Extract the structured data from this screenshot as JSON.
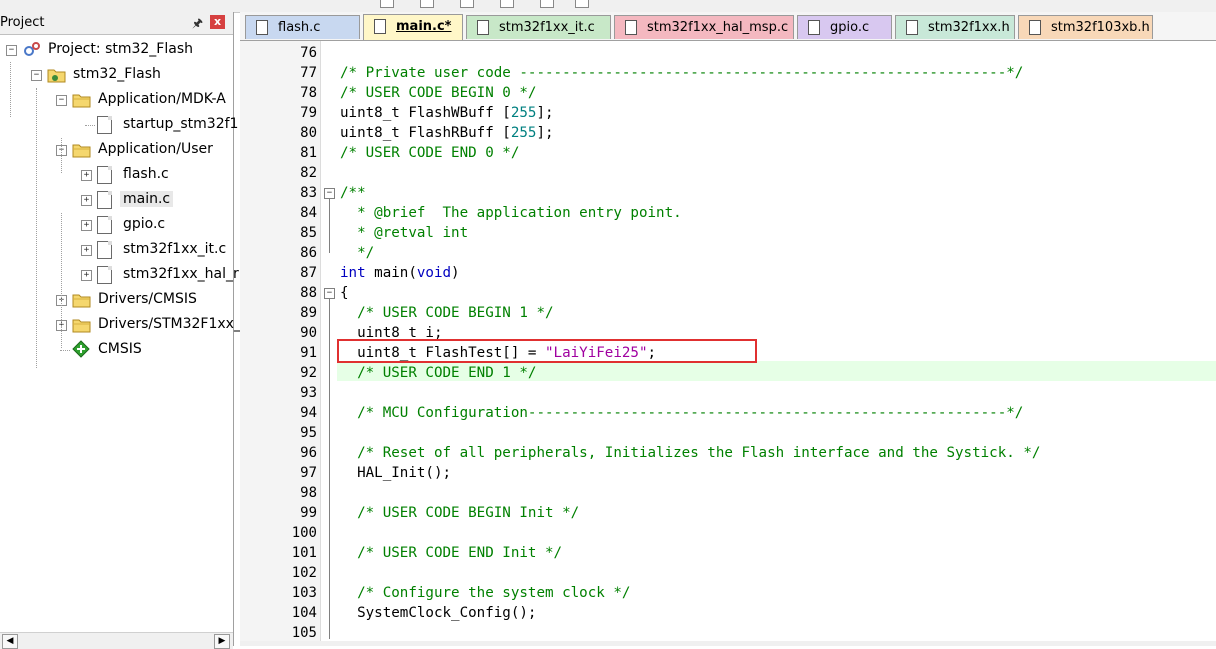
{
  "project_panel": {
    "title": "Project",
    "pin_icon": "pin-icon",
    "close_label": "x",
    "tree": [
      {
        "label": "Project: stm32_Flash",
        "depth": 0,
        "kind": "project",
        "expander": "-"
      },
      {
        "label": "stm32_Flash",
        "depth": 1,
        "kind": "target",
        "expander": "-"
      },
      {
        "label": "Application/MDK-A",
        "depth": 2,
        "kind": "folder",
        "expander": "-"
      },
      {
        "label": "startup_stm32f1",
        "depth": 3,
        "kind": "file",
        "expander": ""
      },
      {
        "label": "Application/User",
        "depth": 2,
        "kind": "folder",
        "expander": "-"
      },
      {
        "label": "flash.c",
        "depth": 3,
        "kind": "file",
        "expander": "+"
      },
      {
        "label": "main.c",
        "depth": 3,
        "kind": "file",
        "expander": "+",
        "selected": true
      },
      {
        "label": "gpio.c",
        "depth": 3,
        "kind": "file",
        "expander": "+"
      },
      {
        "label": "stm32f1xx_it.c",
        "depth": 3,
        "kind": "file",
        "expander": "+"
      },
      {
        "label": "stm32f1xx_hal_r",
        "depth": 3,
        "kind": "file",
        "expander": "+"
      },
      {
        "label": "Drivers/CMSIS",
        "depth": 2,
        "kind": "folder",
        "expander": "+"
      },
      {
        "label": "Drivers/STM32F1xx_",
        "depth": 2,
        "kind": "folder",
        "expander": "+"
      },
      {
        "label": "CMSIS",
        "depth": 2,
        "kind": "component",
        "expander": ""
      }
    ]
  },
  "tabs": [
    {
      "label": "flash.c",
      "color": "#c8d8f0",
      "active": false
    },
    {
      "label": "main.c*",
      "color": "#fff7c8",
      "active": true
    },
    {
      "label": "stm32f1xx_it.c",
      "color": "#c8e8c8",
      "active": false
    },
    {
      "label": "stm32f1xx_hal_msp.c",
      "color": "#f4b8c0",
      "active": false
    },
    {
      "label": "gpio.c",
      "color": "#d8c8f0",
      "active": false
    },
    {
      "label": "stm32f1xx.h",
      "color": "#c8e8d8",
      "active": false
    },
    {
      "label": "stm32f103xb.h",
      "color": "#f8d8b8",
      "active": false
    }
  ],
  "editor": {
    "highlight_color": "#e6ffe6",
    "annotation_color": "#e03030",
    "lines": [
      {
        "n": "76",
        "tokens": []
      },
      {
        "n": "77",
        "tokens": [
          {
            "t": "/* Private user code ---------------------------------------------------------*/",
            "c": "cm"
          }
        ]
      },
      {
        "n": "78",
        "tokens": [
          {
            "t": "/* USER CODE BEGIN 0 */",
            "c": "cm"
          }
        ]
      },
      {
        "n": "79",
        "tokens": [
          {
            "t": "uint8_t FlashWBuff [",
            "c": ""
          },
          {
            "t": "255",
            "c": "num"
          },
          {
            "t": "];",
            "c": ""
          }
        ]
      },
      {
        "n": "80",
        "tokens": [
          {
            "t": "uint8_t FlashRBuff [",
            "c": ""
          },
          {
            "t": "255",
            "c": "num"
          },
          {
            "t": "];",
            "c": ""
          }
        ]
      },
      {
        "n": "81",
        "tokens": [
          {
            "t": "/* USER CODE END 0 */",
            "c": "cm"
          }
        ]
      },
      {
        "n": "82",
        "tokens": []
      },
      {
        "n": "83",
        "tokens": [
          {
            "t": "/**",
            "c": "cm"
          }
        ]
      },
      {
        "n": "84",
        "tokens": [
          {
            "t": "  * @brief  The application entry point.",
            "c": "cm"
          }
        ]
      },
      {
        "n": "85",
        "tokens": [
          {
            "t": "  * @retval int",
            "c": "cm"
          }
        ]
      },
      {
        "n": "86",
        "tokens": [
          {
            "t": "  */",
            "c": "cm"
          }
        ]
      },
      {
        "n": "87",
        "tokens": [
          {
            "t": "int",
            "c": "kw"
          },
          {
            "t": " main(",
            "c": ""
          },
          {
            "t": "void",
            "c": "kw"
          },
          {
            "t": ")",
            "c": ""
          }
        ]
      },
      {
        "n": "88",
        "tokens": [
          {
            "t": "{",
            "c": ""
          }
        ]
      },
      {
        "n": "89",
        "tokens": [
          {
            "t": "  /* USER CODE BEGIN 1 */",
            "c": "cm"
          }
        ]
      },
      {
        "n": "90",
        "tokens": [
          {
            "t": "  uint8_t i;",
            "c": ""
          }
        ]
      },
      {
        "n": "91",
        "tokens": [
          {
            "t": "  uint8_t FlashTest[] = ",
            "c": ""
          },
          {
            "t": "\"LaiYiFei25\"",
            "c": "str"
          },
          {
            "t": ";",
            "c": ""
          }
        ]
      },
      {
        "n": "92",
        "tokens": [
          {
            "t": "  /* USER CODE END 1 */",
            "c": "cm"
          }
        ]
      },
      {
        "n": "93",
        "tokens": []
      },
      {
        "n": "94",
        "tokens": [
          {
            "t": "  /* MCU Configuration--------------------------------------------------------*/",
            "c": "cm"
          }
        ]
      },
      {
        "n": "95",
        "tokens": []
      },
      {
        "n": "96",
        "tokens": [
          {
            "t": "  /* Reset of all peripherals, Initializes the Flash interface and the Systick. */",
            "c": "cm"
          }
        ]
      },
      {
        "n": "97",
        "tokens": [
          {
            "t": "  HAL_Init();",
            "c": ""
          }
        ]
      },
      {
        "n": "98",
        "tokens": []
      },
      {
        "n": "99",
        "tokens": [
          {
            "t": "  /* USER CODE BEGIN Init */",
            "c": "cm"
          }
        ]
      },
      {
        "n": "100",
        "tokens": []
      },
      {
        "n": "101",
        "tokens": [
          {
            "t": "  /* USER CODE END Init */",
            "c": "cm"
          }
        ]
      },
      {
        "n": "102",
        "tokens": []
      },
      {
        "n": "103",
        "tokens": [
          {
            "t": "  /* Configure the system clock */",
            "c": "cm"
          }
        ]
      },
      {
        "n": "104",
        "tokens": [
          {
            "t": "  SystemClock_Config();",
            "c": ""
          }
        ]
      },
      {
        "n": "105",
        "tokens": []
      }
    ]
  }
}
